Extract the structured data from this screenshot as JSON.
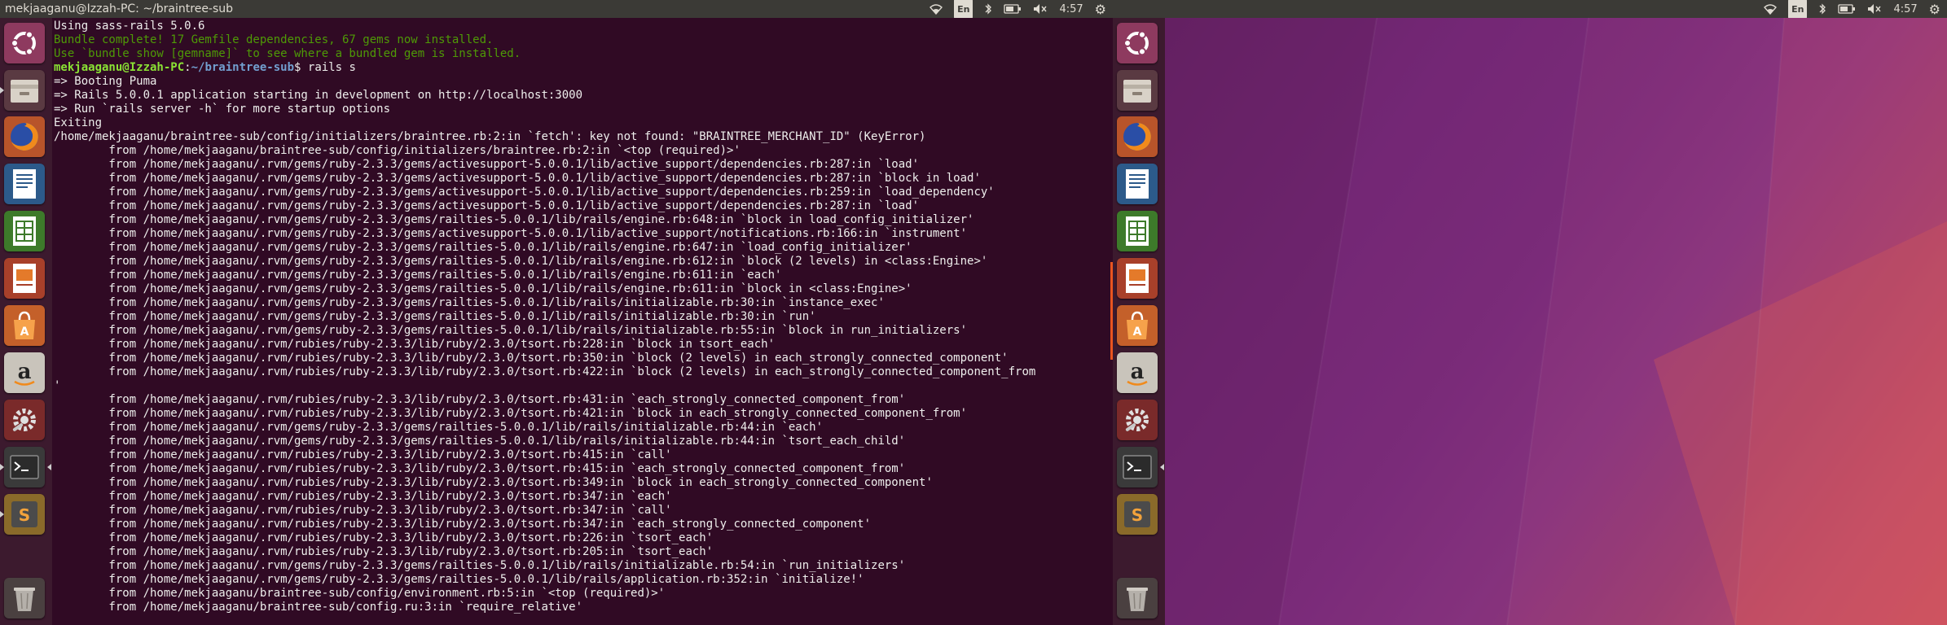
{
  "top_panel": {
    "window_title": "mekjaaganu@Izzah-PC: ~/braintree-sub",
    "language": "En",
    "time": "4:57"
  },
  "right_panel": {
    "language": "En",
    "time": "4:57"
  },
  "launcher_icons": [
    "ubuntu-dash",
    "files",
    "firefox",
    "libreoffice-writer",
    "libreoffice-calc",
    "libreoffice-impress",
    "software-center",
    "amazon",
    "system-settings",
    "terminal",
    "sublime-text",
    "trash"
  ],
  "terminal": {
    "line_green_1": "Bundle complete! 17 Gemfile dependencies, 67 gems now installed.",
    "line_green_2": "Use `bundle show [gemname]` to see where a bundled gem is installed.",
    "line_0": "Using sass-rails 5.0.6",
    "prompt_user": "mekjaaganu@Izzah-PC",
    "prompt_sep": ":",
    "prompt_path": "~/braintree-sub",
    "prompt_cmd": "$ rails s",
    "output": "=> Booting Puma\n=> Rails 5.0.0.1 application starting in development on http://localhost:3000\n=> Run `rails server -h` for more startup options\nExiting\n/home/mekjaaganu/braintree-sub/config/initializers/braintree.rb:2:in `fetch': key not found: \"BRAINTREE_MERCHANT_ID\" (KeyError)\n        from /home/mekjaaganu/braintree-sub/config/initializers/braintree.rb:2:in `<top (required)>'\n        from /home/mekjaaganu/.rvm/gems/ruby-2.3.3/gems/activesupport-5.0.0.1/lib/active_support/dependencies.rb:287:in `load'\n        from /home/mekjaaganu/.rvm/gems/ruby-2.3.3/gems/activesupport-5.0.0.1/lib/active_support/dependencies.rb:287:in `block in load'\n        from /home/mekjaaganu/.rvm/gems/ruby-2.3.3/gems/activesupport-5.0.0.1/lib/active_support/dependencies.rb:259:in `load_dependency'\n        from /home/mekjaaganu/.rvm/gems/ruby-2.3.3/gems/activesupport-5.0.0.1/lib/active_support/dependencies.rb:287:in `load'\n        from /home/mekjaaganu/.rvm/gems/ruby-2.3.3/gems/railties-5.0.0.1/lib/rails/engine.rb:648:in `block in load_config_initializer'\n        from /home/mekjaaganu/.rvm/gems/ruby-2.3.3/gems/activesupport-5.0.0.1/lib/active_support/notifications.rb:166:in `instrument'\n        from /home/mekjaaganu/.rvm/gems/ruby-2.3.3/gems/railties-5.0.0.1/lib/rails/engine.rb:647:in `load_config_initializer'\n        from /home/mekjaaganu/.rvm/gems/ruby-2.3.3/gems/railties-5.0.0.1/lib/rails/engine.rb:612:in `block (2 levels) in <class:Engine>'\n        from /home/mekjaaganu/.rvm/gems/ruby-2.3.3/gems/railties-5.0.0.1/lib/rails/engine.rb:611:in `each'\n        from /home/mekjaaganu/.rvm/gems/ruby-2.3.3/gems/railties-5.0.0.1/lib/rails/engine.rb:611:in `block in <class:Engine>'\n        from /home/mekjaaganu/.rvm/gems/ruby-2.3.3/gems/railties-5.0.0.1/lib/rails/initializable.rb:30:in `instance_exec'\n        from /home/mekjaaganu/.rvm/gems/ruby-2.3.3/gems/railties-5.0.0.1/lib/rails/initializable.rb:30:in `run'\n        from /home/mekjaaganu/.rvm/gems/ruby-2.3.3/gems/railties-5.0.0.1/lib/rails/initializable.rb:55:in `block in run_initializers'\n        from /home/mekjaaganu/.rvm/rubies/ruby-2.3.3/lib/ruby/2.3.0/tsort.rb:228:in `block in tsort_each'\n        from /home/mekjaaganu/.rvm/rubies/ruby-2.3.3/lib/ruby/2.3.0/tsort.rb:350:in `block (2 levels) in each_strongly_connected_component'\n        from /home/mekjaaganu/.rvm/rubies/ruby-2.3.3/lib/ruby/2.3.0/tsort.rb:422:in `block (2 levels) in each_strongly_connected_component_from\n'\n        from /home/mekjaaganu/.rvm/rubies/ruby-2.3.3/lib/ruby/2.3.0/tsort.rb:431:in `each_strongly_connected_component_from'\n        from /home/mekjaaganu/.rvm/rubies/ruby-2.3.3/lib/ruby/2.3.0/tsort.rb:421:in `block in each_strongly_connected_component_from'\n        from /home/mekjaaganu/.rvm/gems/ruby-2.3.3/gems/railties-5.0.0.1/lib/rails/initializable.rb:44:in `each'\n        from /home/mekjaaganu/.rvm/gems/ruby-2.3.3/gems/railties-5.0.0.1/lib/rails/initializable.rb:44:in `tsort_each_child'\n        from /home/mekjaaganu/.rvm/rubies/ruby-2.3.3/lib/ruby/2.3.0/tsort.rb:415:in `call'\n        from /home/mekjaaganu/.rvm/rubies/ruby-2.3.3/lib/ruby/2.3.0/tsort.rb:415:in `each_strongly_connected_component_from'\n        from /home/mekjaaganu/.rvm/rubies/ruby-2.3.3/lib/ruby/2.3.0/tsort.rb:349:in `block in each_strongly_connected_component'\n        from /home/mekjaaganu/.rvm/rubies/ruby-2.3.3/lib/ruby/2.3.0/tsort.rb:347:in `each'\n        from /home/mekjaaganu/.rvm/rubies/ruby-2.3.3/lib/ruby/2.3.0/tsort.rb:347:in `call'\n        from /home/mekjaaganu/.rvm/rubies/ruby-2.3.3/lib/ruby/2.3.0/tsort.rb:347:in `each_strongly_connected_component'\n        from /home/mekjaaganu/.rvm/rubies/ruby-2.3.3/lib/ruby/2.3.0/tsort.rb:226:in `tsort_each'\n        from /home/mekjaaganu/.rvm/rubies/ruby-2.3.3/lib/ruby/2.3.0/tsort.rb:205:in `tsort_each'\n        from /home/mekjaaganu/.rvm/gems/ruby-2.3.3/gems/railties-5.0.0.1/lib/rails/initializable.rb:54:in `run_initializers'\n        from /home/mekjaaganu/.rvm/gems/ruby-2.3.3/gems/railties-5.0.0.1/lib/rails/application.rb:352:in `initialize!'\n        from /home/mekjaaganu/braintree-sub/config/environment.rb:5:in `<top (required)>'\n        from /home/mekjaaganu/braintree-sub/config.ru:3:in `require_relative'"
  },
  "colors": {
    "terminal_bg": "#300a24",
    "panel_bg": "#3b3a36",
    "green_text": "#4e9a06",
    "accent": "#e95420"
  }
}
